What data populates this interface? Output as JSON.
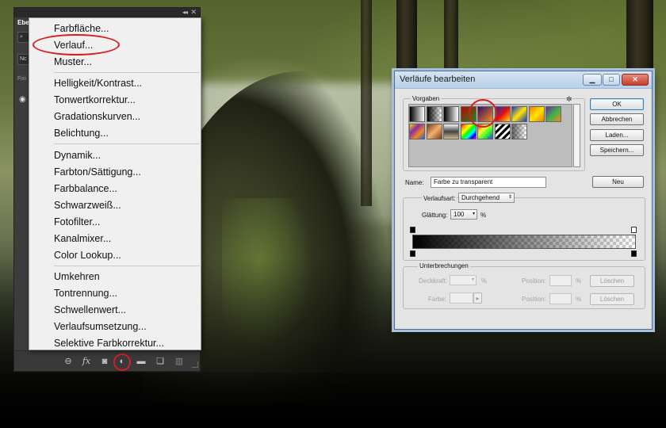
{
  "layers_panel": {
    "tab_label": "Ebe",
    "left_fragments": [
      "Nc",
      "Fixi"
    ],
    "bottom_icons": [
      "link-icon",
      "fx-icon",
      "mask-icon",
      "adjustment-icon",
      "folder-icon",
      "new-layer-icon",
      "trash-icon"
    ],
    "fx_label": "fx"
  },
  "adjustment_menu": {
    "groups": [
      [
        "Farbfläche...",
        "Verlauf...",
        "Muster..."
      ],
      [
        "Helligkeit/Kontrast...",
        "Tonwertkorrektur...",
        "Gradationskurven...",
        "Belichtung..."
      ],
      [
        "Dynamik...",
        "Farbton/Sättigung...",
        "Farbbalance...",
        "Schwarzweiß...",
        "Fotofilter...",
        "Kanalmixer...",
        "Color Lookup..."
      ],
      [
        "Umkehren",
        "Tontrennung...",
        "Schwellenwert...",
        "Verlaufsumsetzung...",
        "Selektive Farbkorrektur..."
      ]
    ],
    "highlighted": "Verlauf...",
    "highlight_color": "#d31f1f"
  },
  "gradient_dialog": {
    "title": "Verläufe bearbeiten",
    "presets_label": "Vorgaben",
    "buttons": {
      "ok": "OK",
      "cancel": "Abbrechen",
      "load": "Laden...",
      "save": "Speichern...",
      "new": "Neu"
    },
    "name_label": "Name:",
    "name_value": "Farbe zu transparent",
    "gradient_type_label": "Verlaufsart:",
    "gradient_type_value": "Durchgehend",
    "smoothness_label": "Glättung:",
    "smoothness_value": "100",
    "smoothness_unit": "%",
    "stops_section_label": "Unterbrechungen",
    "opacity_label": "Deckkraft:",
    "opacity_unit": "%",
    "color_label": "Farbe:",
    "position_label": "Position:",
    "position_unit": "%",
    "delete_label": "Löschen",
    "selected_preset": "black-to-transparent",
    "presets": [
      {
        "name": "foreground-to-background",
        "style": "linear-gradient(90deg,#000,#fff)"
      },
      {
        "name": "foreground-to-transparent",
        "style": "linear-gradient(90deg,#000,rgba(0,0,0,0))"
      },
      {
        "name": "black-white",
        "style": "linear-gradient(90deg,#000,#fff)"
      },
      {
        "name": "red-green",
        "style": "linear-gradient(135deg,#c00000,#1a8a1a)"
      },
      {
        "name": "violet-orange",
        "style": "linear-gradient(135deg,#3b0a6b,#f08a1a)"
      },
      {
        "name": "blue-red-yellow",
        "style": "linear-gradient(135deg,#1f2fbf,#e01010 50%,#ffe000)"
      },
      {
        "name": "blue-yellow-blue",
        "style": "linear-gradient(135deg,#1a36c8,#ffe600 50%,#1a36c8)"
      },
      {
        "name": "orange-yellow-orange",
        "style": "linear-gradient(135deg,#f07800,#ffe600 50%,#f07800)"
      },
      {
        "name": "violet-green-orange",
        "style": "linear-gradient(135deg,#6a2aa8,#3bb34a 50%,#f08a1a)"
      },
      {
        "name": "yellow-violet-orange-blue",
        "style": "linear-gradient(135deg,#f7e000,#8a2aa8 33%,#f08a1a 66%,#2a5ad8)"
      },
      {
        "name": "copper",
        "style": "linear-gradient(135deg,#7a3a10,#f2b070 50%,#7a3a10)"
      },
      {
        "name": "chrome",
        "style": "linear-gradient(180deg,#f5f5f5,#444 50%,#cfb98a)"
      },
      {
        "name": "spectrum",
        "style": "linear-gradient(135deg,red,orange,yellow,lime,cyan,blue,magenta)"
      },
      {
        "name": "transparent-rainbow",
        "style": "linear-gradient(135deg,rgba(255,0,0,.8),rgba(255,255,0,.8),rgba(0,255,0,.8),rgba(0,0,255,.8))"
      },
      {
        "name": "transparent-stripes",
        "style": "repeating-linear-gradient(135deg,#000 0 3px,#fff 3px 6px)"
      },
      {
        "name": "neutral-density",
        "style": "linear-gradient(90deg,rgba(0,0,0,.6),rgba(0,0,0,0))"
      }
    ],
    "gradient_stops": [
      {
        "kind": "opacity",
        "location": 0,
        "color": "#000000"
      },
      {
        "kind": "opacity",
        "location": 100,
        "color": "#ffffff"
      },
      {
        "kind": "color",
        "location": 0,
        "color": "#000000"
      },
      {
        "kind": "color",
        "location": 100,
        "color": "#000000"
      }
    ]
  }
}
